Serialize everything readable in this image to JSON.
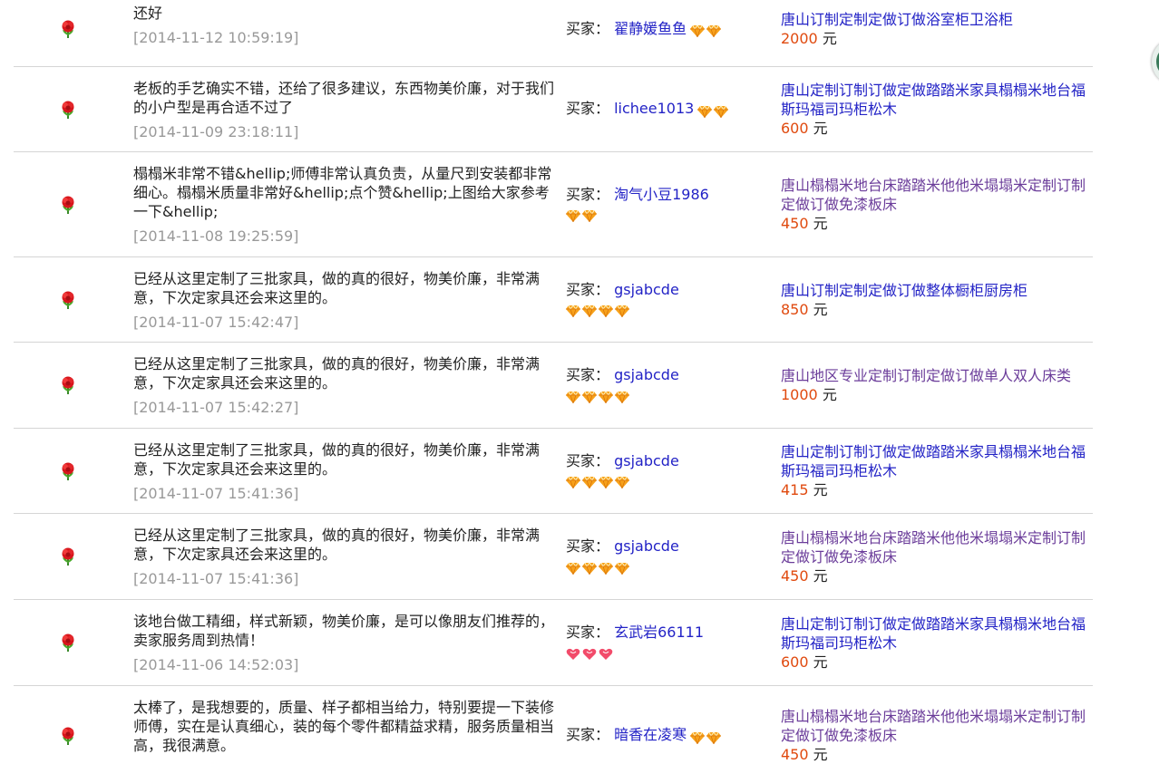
{
  "labels": {
    "buyer_prefix": "买家：",
    "currency": "元"
  },
  "colors": {
    "link": "#2323c6",
    "visited_link": "#6b3d9a",
    "price": "#e04a0f",
    "timestamp": "#999999",
    "divider": "#d5d5d5"
  },
  "rows": [
    {
      "comment": "还好",
      "time": "[2014-11-12 10:59:19]",
      "buyer": "翟静媛鱼鱼",
      "badge_type": "diamond",
      "badge_count": 2,
      "product": "唐山订制定制定做订做浴室柜卫浴柜",
      "product_visited": false,
      "price": "2000"
    },
    {
      "comment": "老板的手艺确实不错，还给了很多建议，东西物美价廉，对于我们的小户型是再合适不过了",
      "time": "[2014-11-09 23:18:11]",
      "buyer": "lichee1013",
      "badge_type": "diamond",
      "badge_count": 2,
      "product": "唐山定制订制订做定做踏踏米家具榻榻米地台福斯玛福司玛柜松木",
      "product_visited": false,
      "price": "600"
    },
    {
      "comment": "榻榻米非常不错&hellip;师傅非常认真负责，从量尺到安装都非常细心。榻榻米质量非常好&hellip;点个赞&hellip;上图给大家参考一下&hellip;",
      "time": "[2014-11-08 19:25:59]",
      "buyer": "淘气小豆1986",
      "badge_type": "diamond",
      "badge_count": 2,
      "product": "唐山榻榻米地台床踏踏米他他米塌塌米定制订制定做订做免漆板床",
      "product_visited": true,
      "price": "450"
    },
    {
      "comment": "已经从这里定制了三批家具，做的真的很好，物美价廉，非常满意，下次定家具还会来这里的。",
      "time": "[2014-11-07 15:42:47]",
      "buyer": "gsjabcde",
      "badge_type": "diamond",
      "badge_count": 4,
      "product": "唐山订制定制定做订做整体橱柜厨房柜",
      "product_visited": false,
      "price": "850"
    },
    {
      "comment": "已经从这里定制了三批家具，做的真的很好，物美价廉，非常满意，下次定家具还会来这里的。",
      "time": "[2014-11-07 15:42:27]",
      "buyer": "gsjabcde",
      "badge_type": "diamond",
      "badge_count": 4,
      "product": "唐山地区专业定制订制定做订做单人双人床类",
      "product_visited": true,
      "price": "1000"
    },
    {
      "comment": "已经从这里定制了三批家具，做的真的很好，物美价廉，非常满意，下次定家具还会来这里的。",
      "time": "[2014-11-07 15:41:36]",
      "buyer": "gsjabcde",
      "badge_type": "diamond",
      "badge_count": 4,
      "product": "唐山定制订制订做定做踏踏米家具榻榻米地台福斯玛福司玛柜松木",
      "product_visited": false,
      "price": "415"
    },
    {
      "comment": "已经从这里定制了三批家具，做的真的很好，物美价廉，非常满意，下次定家具还会来这里的。",
      "time": "[2014-11-07 15:41:36]",
      "buyer": "gsjabcde",
      "badge_type": "diamond",
      "badge_count": 4,
      "product": "唐山榻榻米地台床踏踏米他他米塌塌米定制订制定做订做免漆板床",
      "product_visited": true,
      "price": "450"
    },
    {
      "comment": "该地台做工精细，样式新颖，物美价廉，是可以像朋友们推荐的，卖家服务周到热情！",
      "time": "[2014-11-06 14:52:03]",
      "buyer": "玄武岩66111",
      "badge_type": "heart",
      "badge_count": 3,
      "product": "唐山定制订制订做定做踏踏米家具榻榻米地台福斯玛福司玛柜松木",
      "product_visited": false,
      "price": "600"
    },
    {
      "comment": "太棒了，是我想要的，质量、样子都相当给力，特别要提一下装修师傅，实在是认真细心，装的每个零件都精益求精，服务质量相当高，我很满意。",
      "time": "",
      "buyer": "暗香在凌寒",
      "badge_type": "diamond",
      "badge_count": 2,
      "product": "唐山榻榻米地台床踏踏米他他米塌塌米定制订制定做订做免漆板床",
      "product_visited": true,
      "price": "450"
    }
  ]
}
